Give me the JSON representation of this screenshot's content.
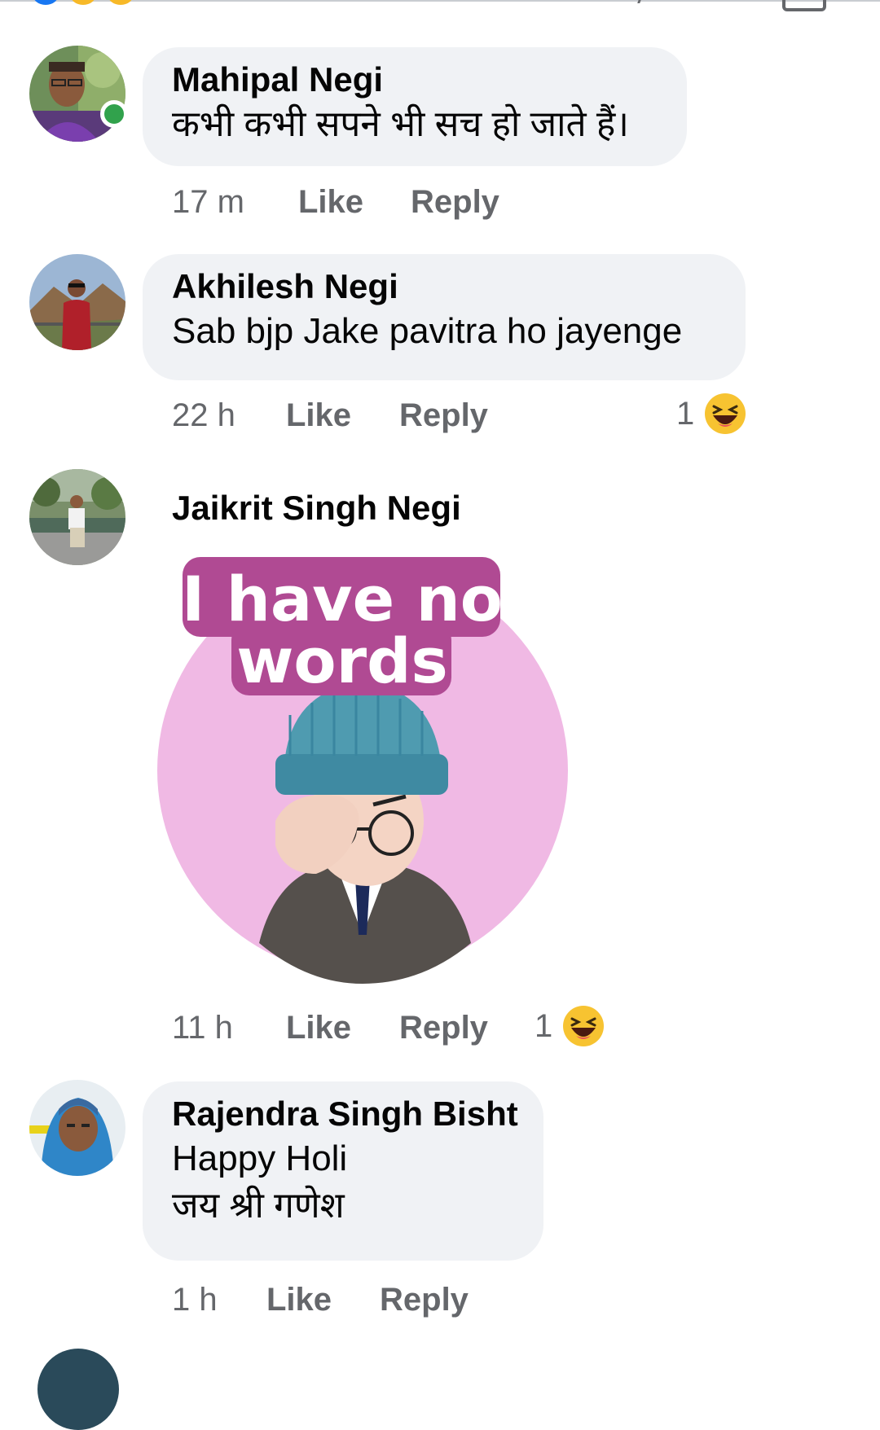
{
  "comments": [
    {
      "author": "Mahipal Negi",
      "text": "कभी कभी सपने भी सच हो जाते हैं।",
      "time": "17 m",
      "like": "Like",
      "reply": "Reply",
      "online": true
    },
    {
      "author": "Akhilesh Negi",
      "text": "Sab bjp Jake pavitra ho jayenge",
      "time": "22 h",
      "like": "Like",
      "reply": "Reply",
      "reaction_count": "1",
      "reaction_icon": "laughing-emoji-icon"
    },
    {
      "author": "Jaikrit Singh Negi",
      "sticker": {
        "line1": "I have no",
        "line2": "words"
      },
      "time": "11 h",
      "like": "Like",
      "reply": "Reply",
      "reaction_count": "1",
      "reaction_icon": "laughing-emoji-icon"
    },
    {
      "author": "Rajendra Singh Bisht",
      "text_line1": "Happy Holi",
      "text_line2": "जय श्री गणेश",
      "time": "1 h",
      "like": "Like",
      "reply": "Reply"
    }
  ],
  "colors": {
    "bubble": "#f0f2f5",
    "meta": "#65676b",
    "online": "#31a24c",
    "sticker_bg": "#f0b9e4",
    "sticker_text_bg": "#b04a93"
  }
}
